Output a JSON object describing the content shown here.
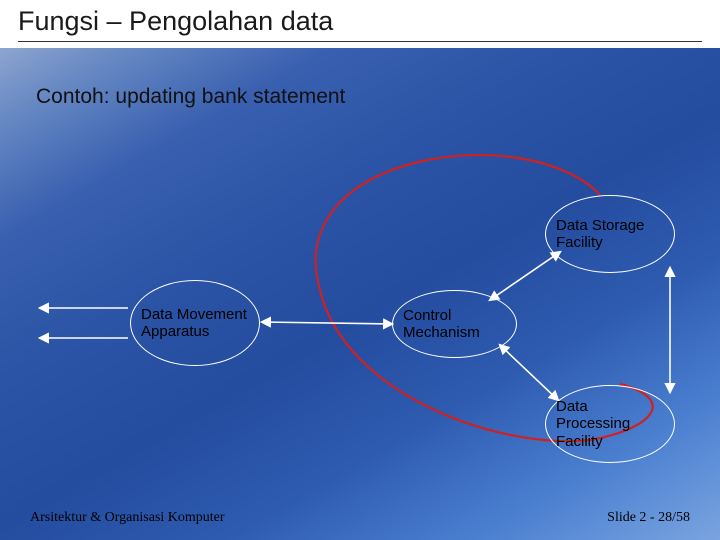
{
  "title": "Fungsi – Pengolahan data",
  "subtitle": "Contoh: updating bank statement",
  "nodes": {
    "storage": "Data Storage Facility",
    "control": "Control Mechanism",
    "movement": "Data Movement Apparatus",
    "processing": "Data Processing Facility"
  },
  "footer": {
    "left": "Arsitektur & Organisasi Komputer",
    "right": "Slide 2 - 28/58"
  },
  "colors": {
    "arrow_white": "#ffffff",
    "highlight_red": "#d02020"
  }
}
